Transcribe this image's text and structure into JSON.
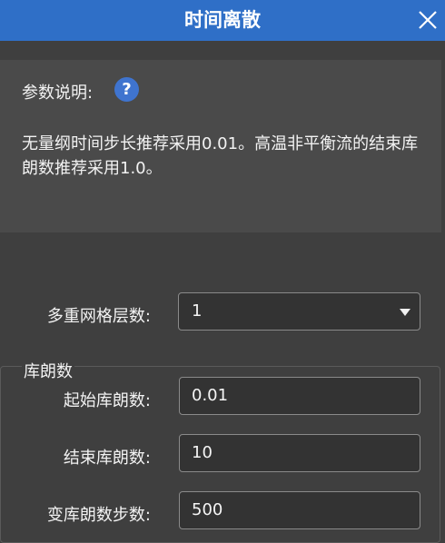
{
  "window": {
    "title": "时间离散",
    "close_icon": "close-icon"
  },
  "info": {
    "label": "参数说明:",
    "help_icon": "question-icon",
    "help_glyph": "?",
    "description": "无量纲时间步长推荐采用0.01。高温非平衡流的结束库朗数推荐采用1.0。"
  },
  "multigrid": {
    "label": "多重网格层数:",
    "selected": "1"
  },
  "cfl_group": {
    "title": "库朗数",
    "start_label": "起始库朗数:",
    "start_value": "0.01",
    "end_label": "结束库朗数:",
    "end_value": "10",
    "steps_label": "变库朗数步数:",
    "steps_value": "500"
  },
  "colors": {
    "titlebar": "#2f6fc7",
    "background": "#3f3f3f",
    "panel": "#4a4a4a",
    "help": "#3f74cf"
  }
}
